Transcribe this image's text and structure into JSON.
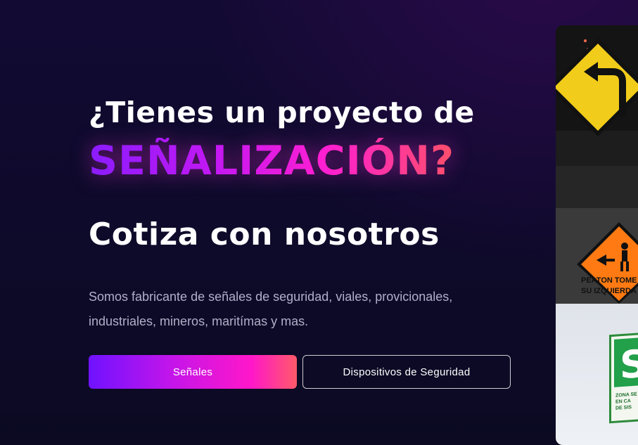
{
  "hero": {
    "line1": "¿Tienes un proyecto de",
    "line2": "SEÑALIZACIÓN?",
    "line3": "Cotiza con nosotros",
    "description": "Somos fabricante de señales de seguridad, viales, provicionales, industriales, mineros, maritímas y mas.",
    "primary_button": "Señales",
    "secondary_button": "Dispositivos de Seguridad"
  },
  "images": {
    "sign2_line1": "PEATON TOME",
    "sign2_line2": "SU IZQUIERDA",
    "sign3_big": "S",
    "sign3_line1": "ZONA SE",
    "sign3_line2": "EN CA",
    "sign3_line3": "DE SIS"
  },
  "colors": {
    "background": "#0e0a2a",
    "accent_purple": "#8a1cff",
    "accent_pink": "#ff1fd0",
    "accent_coral": "#ff4f6a",
    "description_text": "#b3aec8"
  }
}
